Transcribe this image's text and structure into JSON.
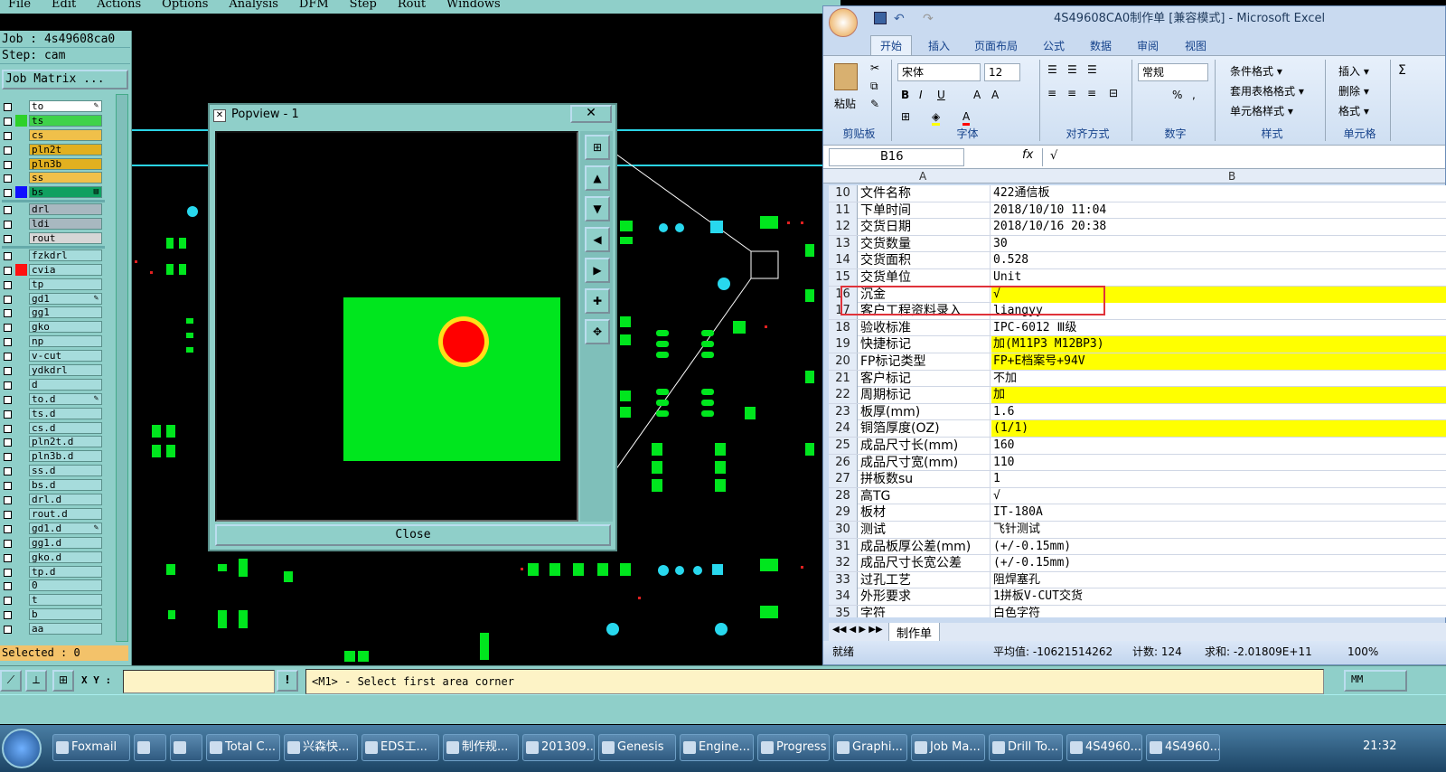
{
  "genesis": {
    "menu": [
      "File",
      "Edit",
      "Actions",
      "Options",
      "Analysis",
      "DFM",
      "Step",
      "Rout",
      "Windows"
    ],
    "job_label": "Job : 4s49608ca0",
    "step_label": "Step: cam",
    "job_matrix": "Job Matrix ...",
    "layers": [
      {
        "name": "to",
        "color": "#ffffff",
        "ind": "",
        "mark": "✎"
      },
      {
        "name": "ts",
        "color": "#3fd24a",
        "ind": "#2ed12a",
        "mark": ""
      },
      {
        "name": "cs",
        "color": "#f0c04a",
        "ind": "",
        "mark": ""
      },
      {
        "name": "pln2t",
        "color": "#e2b020",
        "ind": "",
        "mark": ""
      },
      {
        "name": "pln3b",
        "color": "#e2b020",
        "ind": "",
        "mark": ""
      },
      {
        "name": "ss",
        "color": "#f0c04a",
        "ind": "",
        "mark": ""
      },
      {
        "name": "bs",
        "color": "#10a060",
        "ind": "#1010ff",
        "mark": "▤"
      },
      {
        "name": "drl",
        "color": "#a8b8c0",
        "ind": "",
        "mark": ""
      },
      {
        "name": "ldi",
        "color": "#a8b8c0",
        "ind": "",
        "mark": ""
      },
      {
        "name": "rout",
        "color": "#d6d6d6",
        "ind": "",
        "mark": ""
      },
      {
        "name": "fzkdrl",
        "color": "#a6dcdc",
        "ind": "",
        "mark": ""
      },
      {
        "name": "cvia",
        "color": "#a6dcdc",
        "ind": "#ff1010",
        "mark": ""
      },
      {
        "name": "tp",
        "color": "#a6dcdc",
        "ind": "",
        "mark": ""
      },
      {
        "name": "gd1",
        "color": "#a6dcdc",
        "ind": "",
        "mark": "✎"
      },
      {
        "name": "gg1",
        "color": "#a6dcdc",
        "ind": "",
        "mark": ""
      },
      {
        "name": "gko",
        "color": "#a6dcdc",
        "ind": "",
        "mark": ""
      },
      {
        "name": "np",
        "color": "#a6dcdc",
        "ind": "",
        "mark": ""
      },
      {
        "name": "v-cut",
        "color": "#a6dcdc",
        "ind": "",
        "mark": ""
      },
      {
        "name": "ydkdrl",
        "color": "#a6dcdc",
        "ind": "",
        "mark": ""
      },
      {
        "name": "d",
        "color": "#a6dcdc",
        "ind": "",
        "mark": ""
      },
      {
        "name": "to.d",
        "color": "#a6dcdc",
        "ind": "",
        "mark": "✎"
      },
      {
        "name": "ts.d",
        "color": "#a6dcdc",
        "ind": "",
        "mark": ""
      },
      {
        "name": "cs.d",
        "color": "#a6dcdc",
        "ind": "",
        "mark": ""
      },
      {
        "name": "pln2t.d",
        "color": "#a6dcdc",
        "ind": "",
        "mark": ""
      },
      {
        "name": "pln3b.d",
        "color": "#a6dcdc",
        "ind": "",
        "mark": ""
      },
      {
        "name": "ss.d",
        "color": "#a6dcdc",
        "ind": "",
        "mark": ""
      },
      {
        "name": "bs.d",
        "color": "#a6dcdc",
        "ind": "",
        "mark": ""
      },
      {
        "name": "drl.d",
        "color": "#a6dcdc",
        "ind": "",
        "mark": ""
      },
      {
        "name": "rout.d",
        "color": "#a6dcdc",
        "ind": "",
        "mark": ""
      },
      {
        "name": "gd1.d",
        "color": "#a6dcdc",
        "ind": "",
        "mark": "✎"
      },
      {
        "name": "gg1.d",
        "color": "#a6dcdc",
        "ind": "",
        "mark": ""
      },
      {
        "name": "gko.d",
        "color": "#a6dcdc",
        "ind": "",
        "mark": ""
      },
      {
        "name": "tp.d",
        "color": "#a6dcdc",
        "ind": "",
        "mark": ""
      },
      {
        "name": "0",
        "color": "#a6dcdc",
        "ind": "",
        "mark": ""
      },
      {
        "name": "t",
        "color": "#a6dcdc",
        "ind": "",
        "mark": ""
      },
      {
        "name": "b",
        "color": "#a6dcdc",
        "ind": "",
        "mark": ""
      },
      {
        "name": "aa",
        "color": "#a6dcdc",
        "ind": "",
        "mark": ""
      }
    ],
    "selected": "Selected : 0",
    "xy_label": "X Y :",
    "xy_value": "",
    "status_message": "<M1> - Select first area corner",
    "units": "MM",
    "popview": {
      "title": "Popview - 1",
      "close_x": "✕",
      "close_button": "Close"
    }
  },
  "excel": {
    "title": "4S49608CA0制作单  [兼容模式] - Microsoft Excel",
    "tabs": [
      "开始",
      "插入",
      "页面布局",
      "公式",
      "数据",
      "审阅",
      "视图"
    ],
    "ribbon": {
      "clipboard_label": "剪贴板",
      "paste": "粘贴",
      "font_label": "字体",
      "font_name": "宋体",
      "font_size": "12",
      "align_label": "对齐方式",
      "number_label": "数字",
      "number_format": "常规",
      "styles_label": "样式",
      "cond_format": "条件格式 ▾",
      "table_format": "套用表格格式 ▾",
      "cell_style": "单元格样式 ▾",
      "cells_label": "单元格",
      "insert": "插入 ▾",
      "delete": "删除 ▾",
      "format": "格式 ▾"
    },
    "name_box": "B16",
    "formula_value": "√",
    "col_a": "A",
    "col_b": "B",
    "rows": [
      {
        "n": "10",
        "a": "文件名称",
        "b": "422通信板",
        "hl": false
      },
      {
        "n": "11",
        "a": "下单时间",
        "b": "2018/10/10 11:04",
        "hl": false
      },
      {
        "n": "12",
        "a": "交货日期",
        "b": "2018/10/16 20:38",
        "hl": false
      },
      {
        "n": "13",
        "a": "交货数量",
        "b": "30",
        "hl": false
      },
      {
        "n": "14",
        "a": "交货面积",
        "b": "0.528",
        "hl": false
      },
      {
        "n": "15",
        "a": "交货单位",
        "b": "Unit",
        "hl": false
      },
      {
        "n": "16",
        "a": "沉金",
        "b": "√",
        "hl": true
      },
      {
        "n": "17",
        "a": "客户工程资料录入",
        "b": "liangyy",
        "hl": false
      },
      {
        "n": "18",
        "a": "验收标准",
        "b": "IPC-6012 Ⅲ级",
        "hl": false
      },
      {
        "n": "19",
        "a": "快捷标记",
        "b": "加(M11P3 M12BP3)",
        "hl": true
      },
      {
        "n": "20",
        "a": "FP标记类型",
        "b": "FP+E档案号+94V",
        "hl": true
      },
      {
        "n": "21",
        "a": "客户标记",
        "b": "不加",
        "hl": false
      },
      {
        "n": "22",
        "a": "周期标记",
        "b": "加",
        "hl": true
      },
      {
        "n": "23",
        "a": "板厚(mm)",
        "b": "1.6",
        "hl": false
      },
      {
        "n": "24",
        "a": "铜箔厚度(OZ)",
        "b": " (1/1)",
        "hl": true
      },
      {
        "n": "25",
        "a": "成品尺寸长(mm)",
        "b": "160",
        "hl": false
      },
      {
        "n": "26",
        "a": "成品尺寸宽(mm)",
        "b": "110",
        "hl": false
      },
      {
        "n": "27",
        "a": "拼板数su",
        "b": "1",
        "hl": false
      },
      {
        "n": "28",
        "a": "高TG",
        "b": "√",
        "hl": false
      },
      {
        "n": "29",
        "a": "板材",
        "b": "IT-180A",
        "hl": false
      },
      {
        "n": "30",
        "a": "测试",
        "b": "飞针测试",
        "hl": false
      },
      {
        "n": "31",
        "a": "成品板厚公差(mm)",
        "b": "(+/-0.15mm)",
        "hl": false
      },
      {
        "n": "32",
        "a": "成品尺寸长宽公差",
        "b": "(+/-0.15mm)",
        "hl": false
      },
      {
        "n": "33",
        "a": "过孔工艺",
        "b": "阻焊塞孔",
        "hl": false
      },
      {
        "n": "34",
        "a": "外形要求",
        "b": "1拼板V-CUT交货",
        "hl": false
      },
      {
        "n": "35",
        "a": "字符",
        "b": "白色字符",
        "hl": false
      }
    ],
    "sheet_tab": "制作单",
    "status_ready": "就绪",
    "status_avg": "平均值: -10621514262",
    "status_count": "计数: 124",
    "status_sum": "求和: -2.01809E+11",
    "zoom": "100%"
  },
  "taskbar": {
    "items": [
      "Foxmail",
      "",
      "",
      "Total C...",
      "兴森快...",
      "EDS工...",
      "制作规...",
      "201309...",
      "Genesis",
      "Engine...",
      "Progress",
      "Graphi...",
      "Job Ma...",
      "Drill To...",
      "4S4960...",
      "4S4960..."
    ],
    "clock": "21:32"
  }
}
